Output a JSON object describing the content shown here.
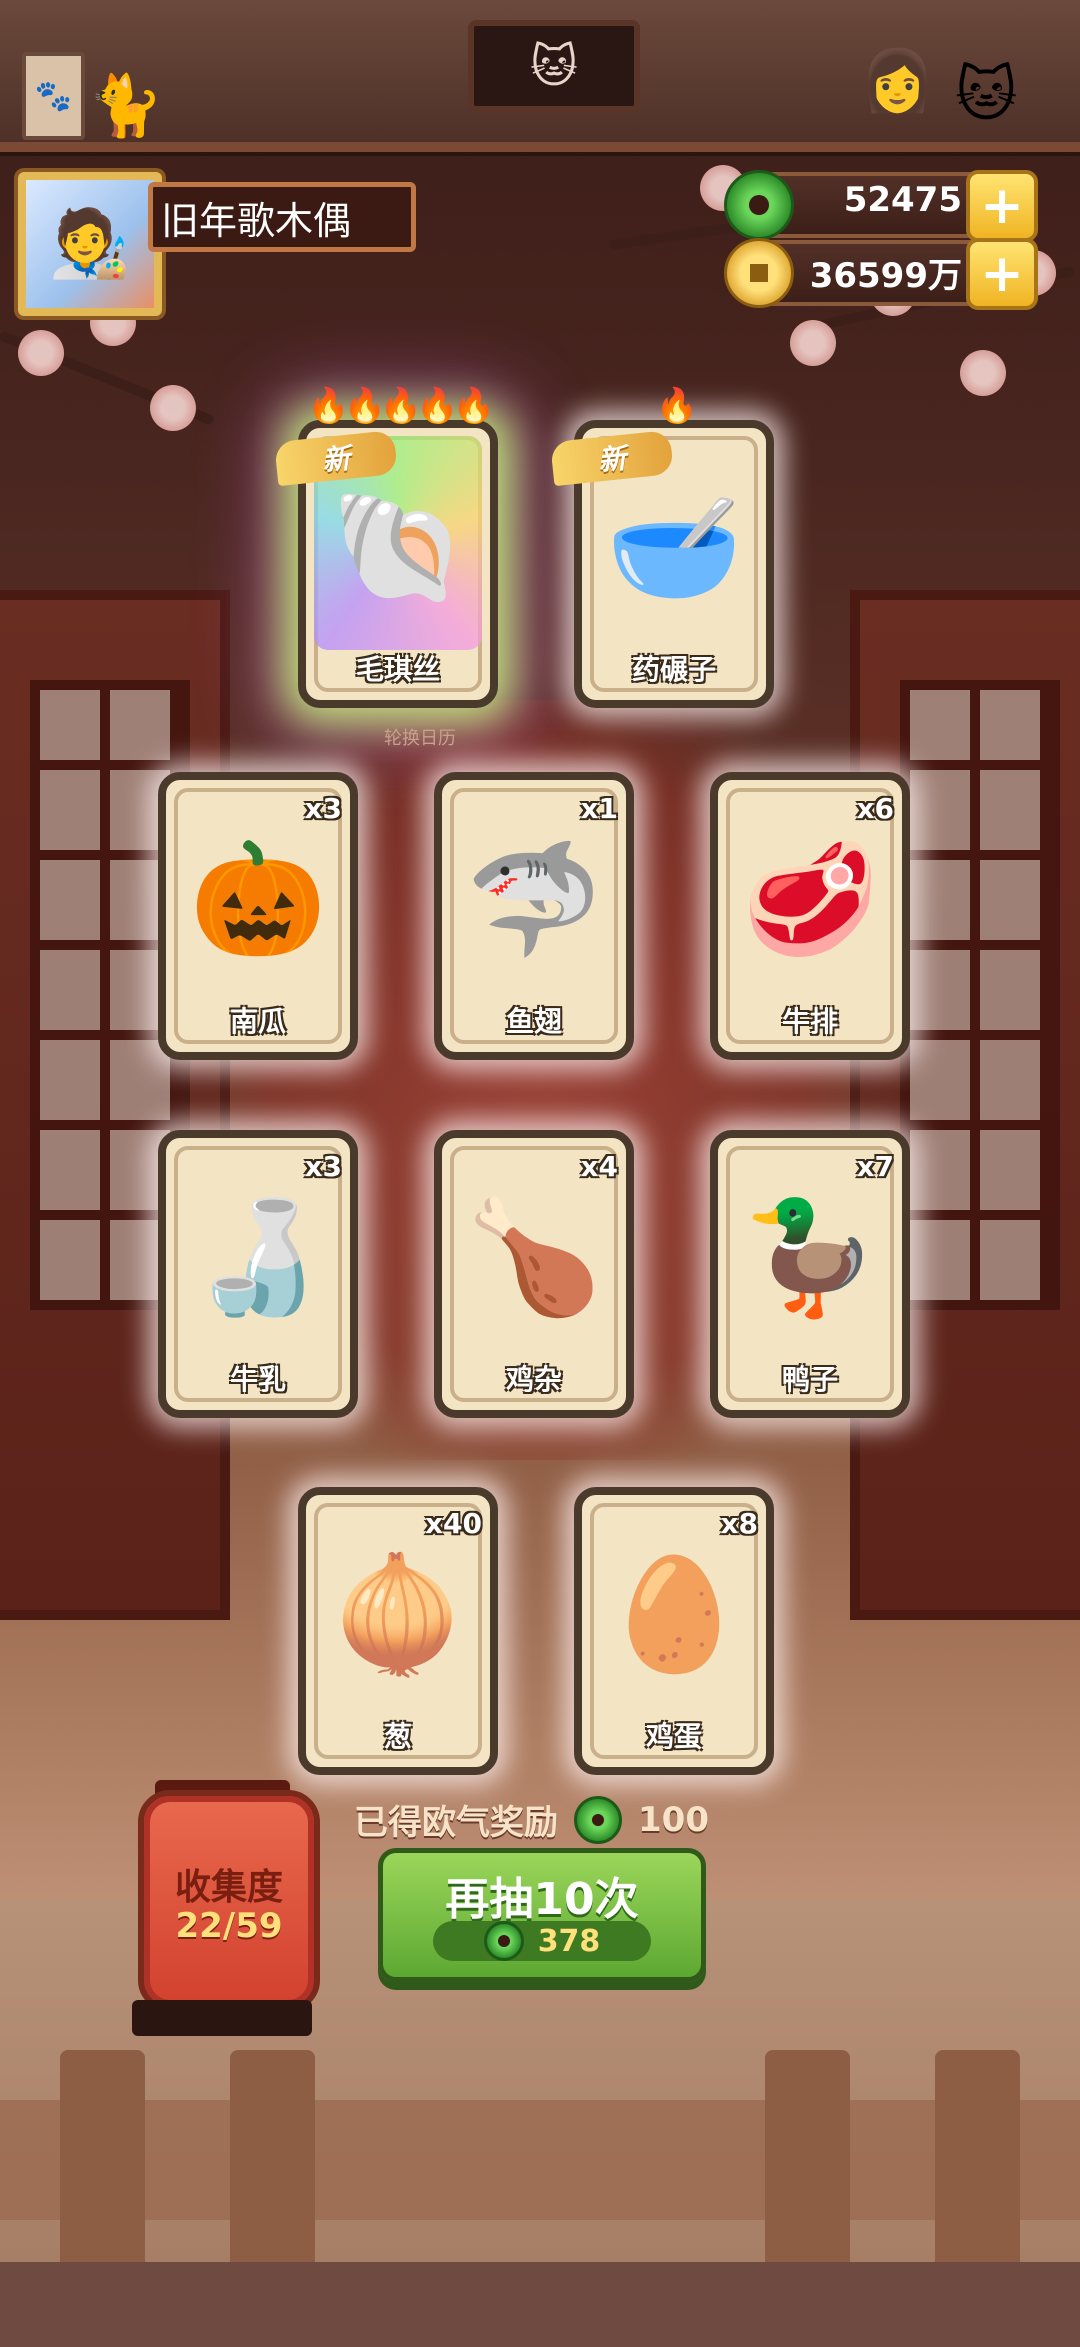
{
  "player": {
    "name": "旧年歌木偶"
  },
  "currencies": [
    {
      "name": "jade",
      "value": "52475"
    },
    {
      "name": "coins",
      "value": "36599万"
    }
  ],
  "banner_subtitle": "轮换日历",
  "cards": {
    "featured": [
      {
        "label": "毛琪丝",
        "new_badge": "新",
        "flames": 5,
        "rarity": "legendary",
        "icon": "hermit-cat"
      },
      {
        "label": "药碾子",
        "new_badge": "新",
        "flames": 1,
        "rarity": "common",
        "icon": "grinder"
      }
    ],
    "row2": [
      {
        "label": "南瓜",
        "qty": "x3",
        "icon": "pumpkin"
      },
      {
        "label": "鱼翅",
        "qty": "x1",
        "icon": "shark-fin"
      },
      {
        "label": "牛排",
        "qty": "x6",
        "icon": "steak"
      }
    ],
    "row3": [
      {
        "label": "牛乳",
        "qty": "x3",
        "icon": "milk-jar"
      },
      {
        "label": "鸡杂",
        "qty": "x4",
        "icon": "chicken-giblets"
      },
      {
        "label": "鸭子",
        "qty": "x7",
        "icon": "duck"
      }
    ],
    "row4": [
      {
        "label": "葱",
        "qty": "x40",
        "icon": "scallion"
      },
      {
        "label": "鸡蛋",
        "qty": "x8",
        "icon": "egg"
      }
    ]
  },
  "collection": {
    "title": "收集度",
    "value": "22/59"
  },
  "reward": {
    "label": "已得欧气奖励",
    "value": "100"
  },
  "draw_button": {
    "label": "再抽10次",
    "cost": "378"
  },
  "colors": {
    "jade": "#4fb83c",
    "gold": "#f0b423",
    "draw_green": "#7bc24a",
    "lantern_red": "#d9493a"
  }
}
